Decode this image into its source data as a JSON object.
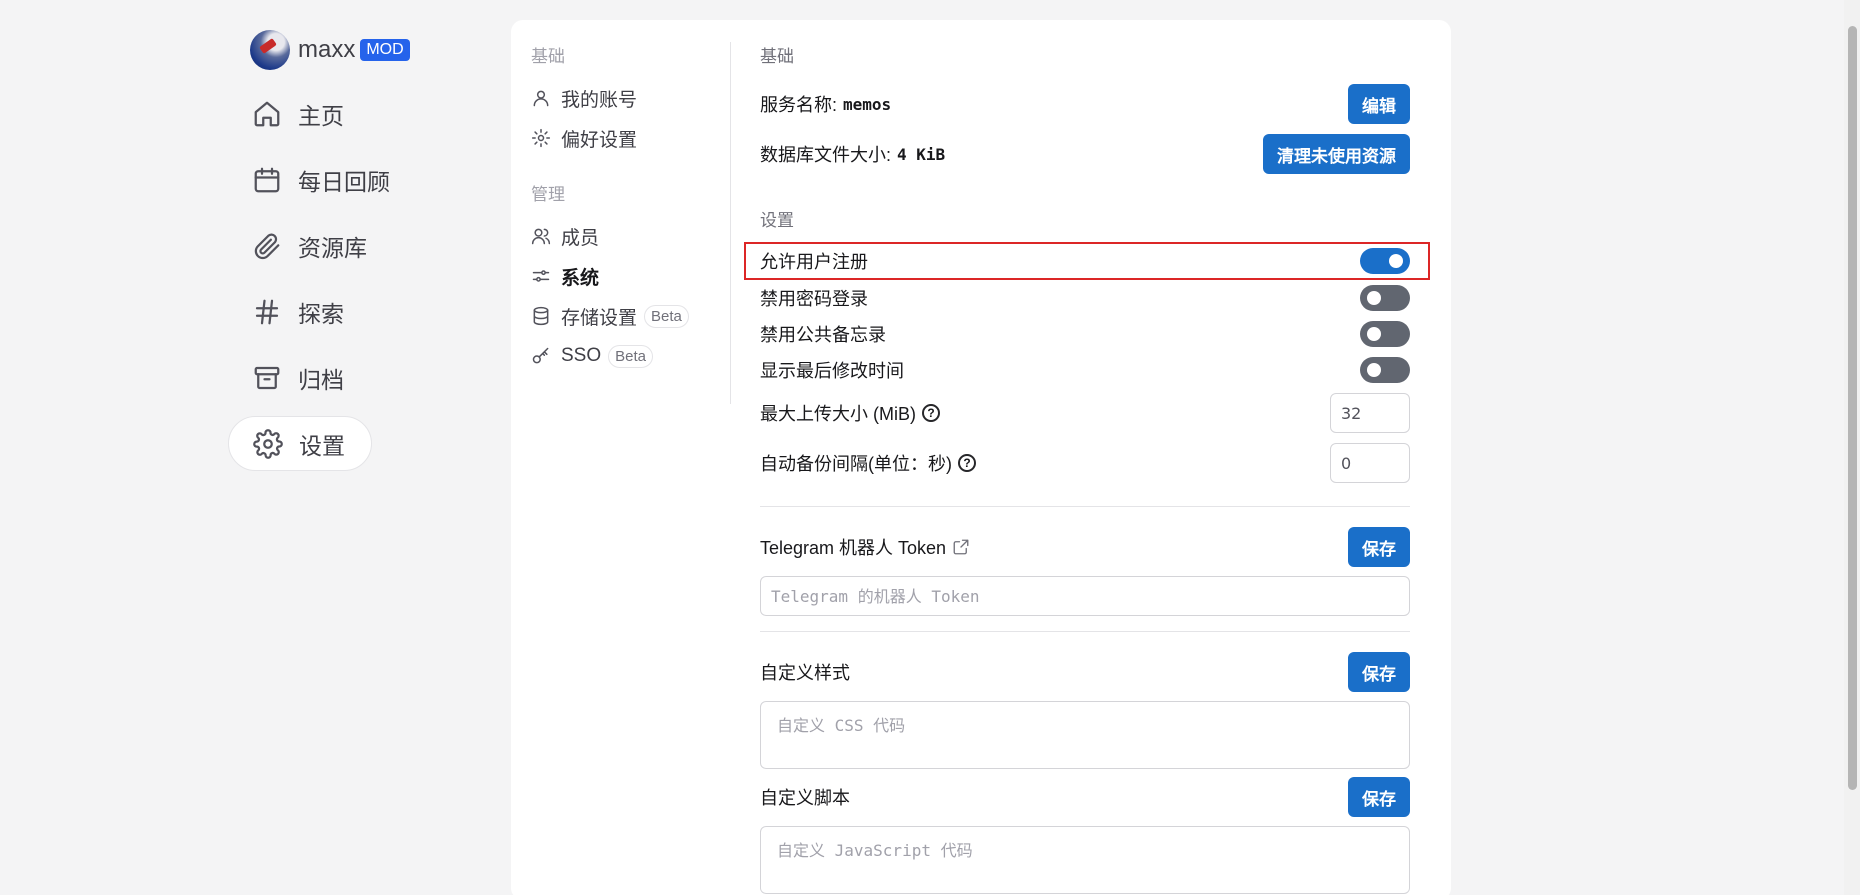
{
  "brand": {
    "name": "maxx",
    "badge": "MOD"
  },
  "nav": {
    "items": [
      {
        "label": "主页",
        "icon": "home-icon"
      },
      {
        "label": "每日回顾",
        "icon": "calendar-icon"
      },
      {
        "label": "资源库",
        "icon": "paperclip-icon"
      },
      {
        "label": "探索",
        "icon": "hash-icon"
      },
      {
        "label": "归档",
        "icon": "archive-icon"
      },
      {
        "label": "设置",
        "icon": "gear-icon",
        "active": true
      }
    ]
  },
  "sidebar": {
    "section_basic": "基础",
    "section_admin": "管理",
    "items": [
      {
        "label": "我的账号",
        "icon": "user-icon"
      },
      {
        "label": "偏好设置",
        "icon": "cog-icon"
      },
      {
        "label": "成员",
        "icon": "users-icon"
      },
      {
        "label": "系统",
        "icon": "sliders-icon",
        "active": true
      },
      {
        "label": "存储设置",
        "icon": "database-icon",
        "badge": "Beta"
      },
      {
        "label": "SSO",
        "icon": "key-icon",
        "badge": "Beta"
      }
    ]
  },
  "system": {
    "section_basic": "基础",
    "service_name_label": "服务名称:",
    "service_name_value": "memos",
    "edit_button": "编辑",
    "db_size_label": "数据库文件大小:",
    "db_size_value": "4 KiB",
    "cleanup_button": "清理未使用资源",
    "section_settings": "设置",
    "toggles": [
      {
        "label": "允许用户注册",
        "on": true
      },
      {
        "label": "禁用密码登录",
        "on": false
      },
      {
        "label": "禁用公共备忘录",
        "on": false
      },
      {
        "label": "显示最后修改时间",
        "on": false
      }
    ],
    "max_upload_label": "最大上传大小 (MiB)",
    "max_upload_value": "32",
    "backup_interval_label": "自动备份间隔(单位：秒)",
    "backup_interval_value": "0",
    "telegram_label": "Telegram 机器人 Token",
    "telegram_placeholder": "Telegram 的机器人 Token",
    "custom_style_label": "自定义样式",
    "custom_style_placeholder": "自定义 CSS 代码",
    "custom_script_label": "自定义脚本",
    "custom_script_placeholder": "自定义 JavaScript 代码",
    "save_button": "保存"
  },
  "colors": {
    "accent": "#1a6fc9",
    "highlight": "#dc2626",
    "badge": "#2563eb"
  }
}
